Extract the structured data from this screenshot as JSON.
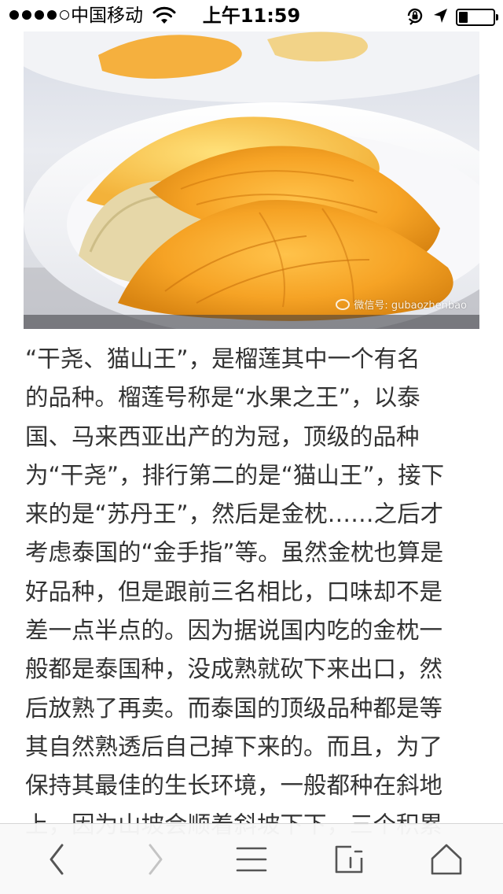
{
  "status_bar": {
    "carrier": "中国移动",
    "time": "上午11:59",
    "signal_bars_filled": 4,
    "signal_bars_total": 5,
    "battery_level": 0.25
  },
  "photo": {
    "watermark": "微信号: gubaozhenbao"
  },
  "article": {
    "lines": [
      "“干尧、猫山王”，是榴莲其中一个有名",
      "的品种。榴莲号称是“水果之王”，以泰",
      "国、马来西亚出产的为冠，顶级的品种",
      "为“干尧”，排行第二的是“猫山王”，接下",
      "来的是“苏丹王”，然后是金枕……之后才",
      "考虑泰国的“金手指”等。虽然金枕也算是",
      "好品种，但是跟前三名相比，口味却不是",
      "差一点半点的。因为据说国内吃的金枕一",
      "般都是泰国种，没成熟就砍下来出口，然",
      "后放熟了再卖。而泰国的顶级品种都是等",
      "其自然熟透后自己掉下来的。而且，为了",
      "保持其最佳的生长环境，一般都种在斜地",
      "上，因为山坡会顺着斜坡下下，三个积累"
    ]
  },
  "toolbar": {
    "buttons": [
      {
        "name": "back-button",
        "icon": "chevron-left-icon",
        "enabled": true
      },
      {
        "name": "forward-button",
        "icon": "chevron-right-icon",
        "enabled": false
      },
      {
        "name": "menu-button",
        "icon": "hamburger-icon",
        "enabled": true
      },
      {
        "name": "tabs-button",
        "icon": "tabs-icon",
        "enabled": true
      },
      {
        "name": "home-button",
        "icon": "home-icon",
        "enabled": true
      }
    ]
  },
  "colors": {
    "text": "#333333",
    "toolbar_bg": "#f9f9f9",
    "icon": "#555555",
    "icon_disabled": "#c4c4c4"
  }
}
